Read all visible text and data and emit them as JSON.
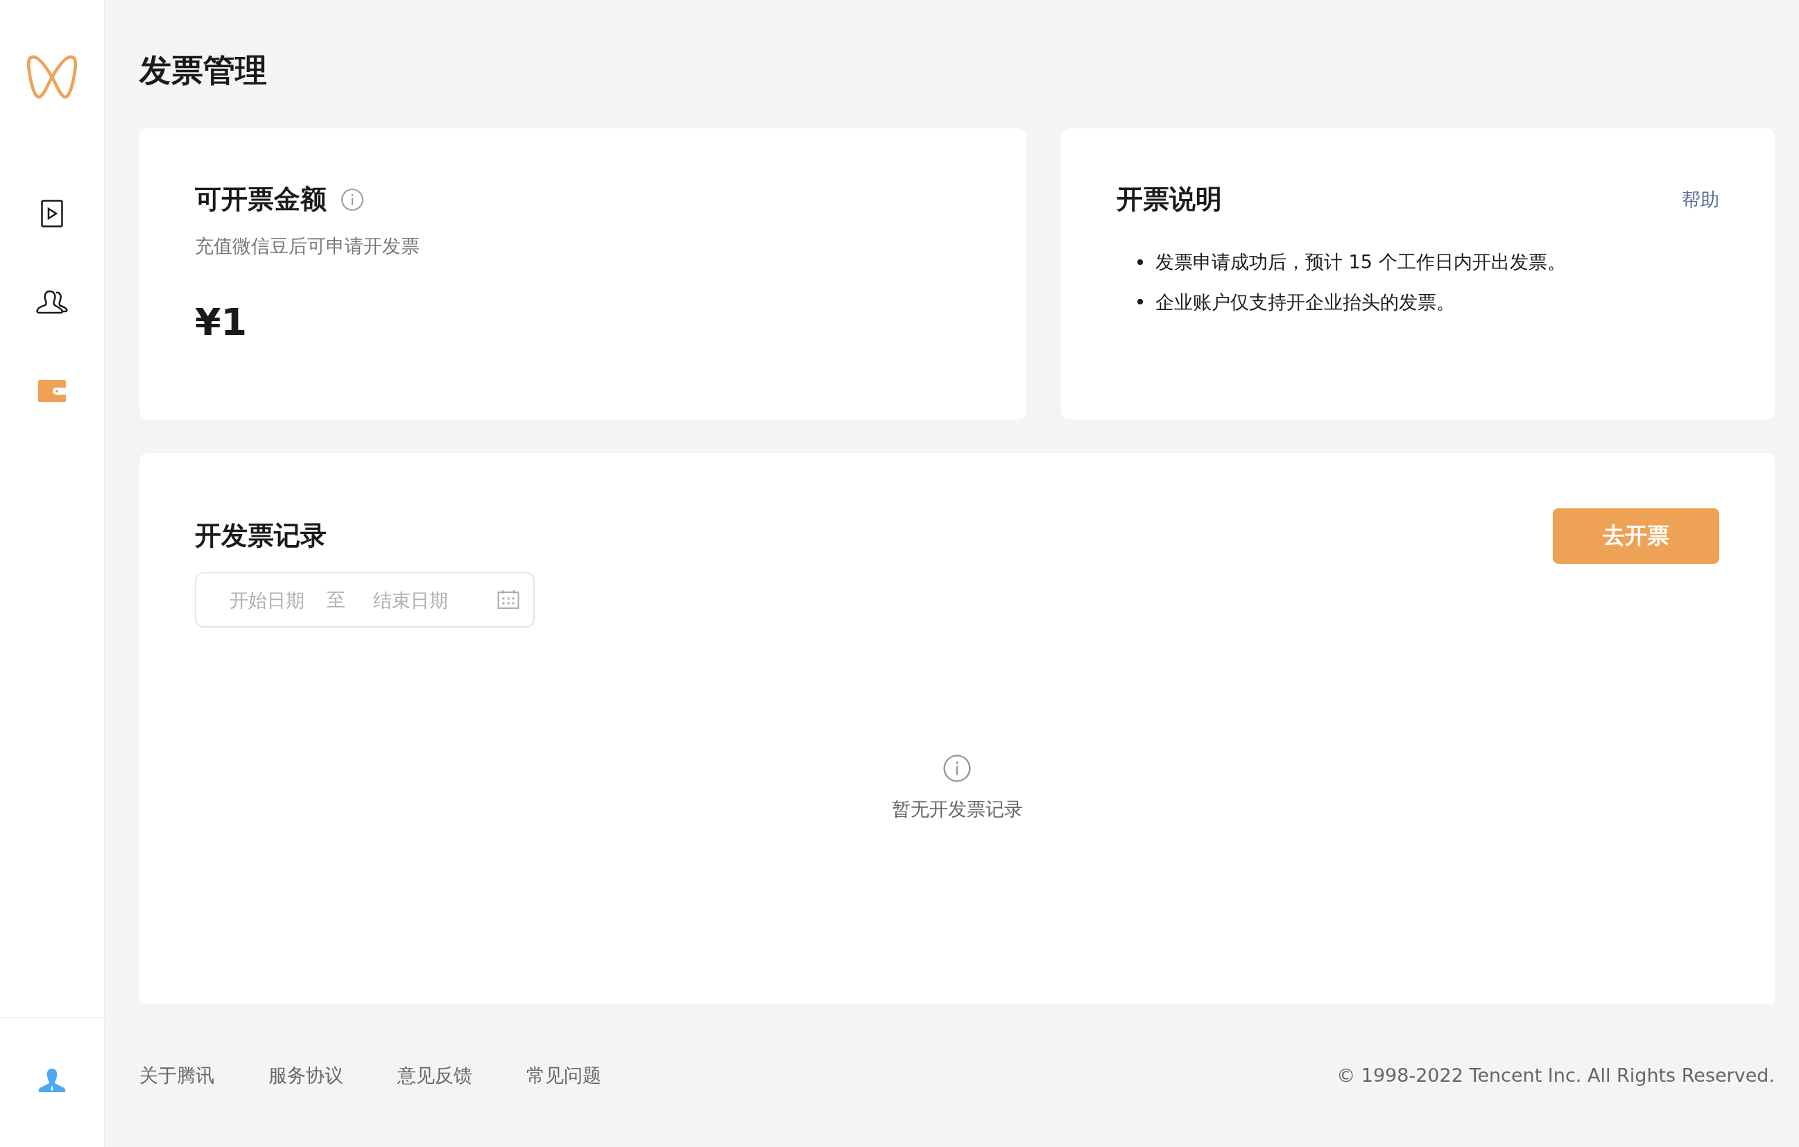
{
  "sidebar": {
    "nav_items": [
      {
        "kind": "video",
        "selected": false
      },
      {
        "kind": "contacts",
        "selected": false
      },
      {
        "kind": "wallet",
        "selected": true
      }
    ]
  },
  "title": "发票管理",
  "balance_card": {
    "title": "可开票金额",
    "subtitle": "充值微信豆后可申请开发票",
    "amount": "¥1"
  },
  "notes_card": {
    "title": "开票说明",
    "help_link": "帮助",
    "items": [
      "发票申请成功后，预计 15 个工作日内开出发票。",
      "企业账户仅支持开企业抬头的发票。"
    ]
  },
  "records": {
    "title": "开发票记录",
    "button": "去开票",
    "date_range": {
      "start_placeholder": "开始日期",
      "separator": "至",
      "end_placeholder": "结束日期"
    },
    "empty_text": "暂无开发票记录"
  },
  "footer": {
    "links": [
      "关于腾讯",
      "服务协议",
      "意见反馈",
      "常见问题"
    ],
    "copyright": "© 1998-2022 Tencent Inc. All Rights Reserved."
  }
}
